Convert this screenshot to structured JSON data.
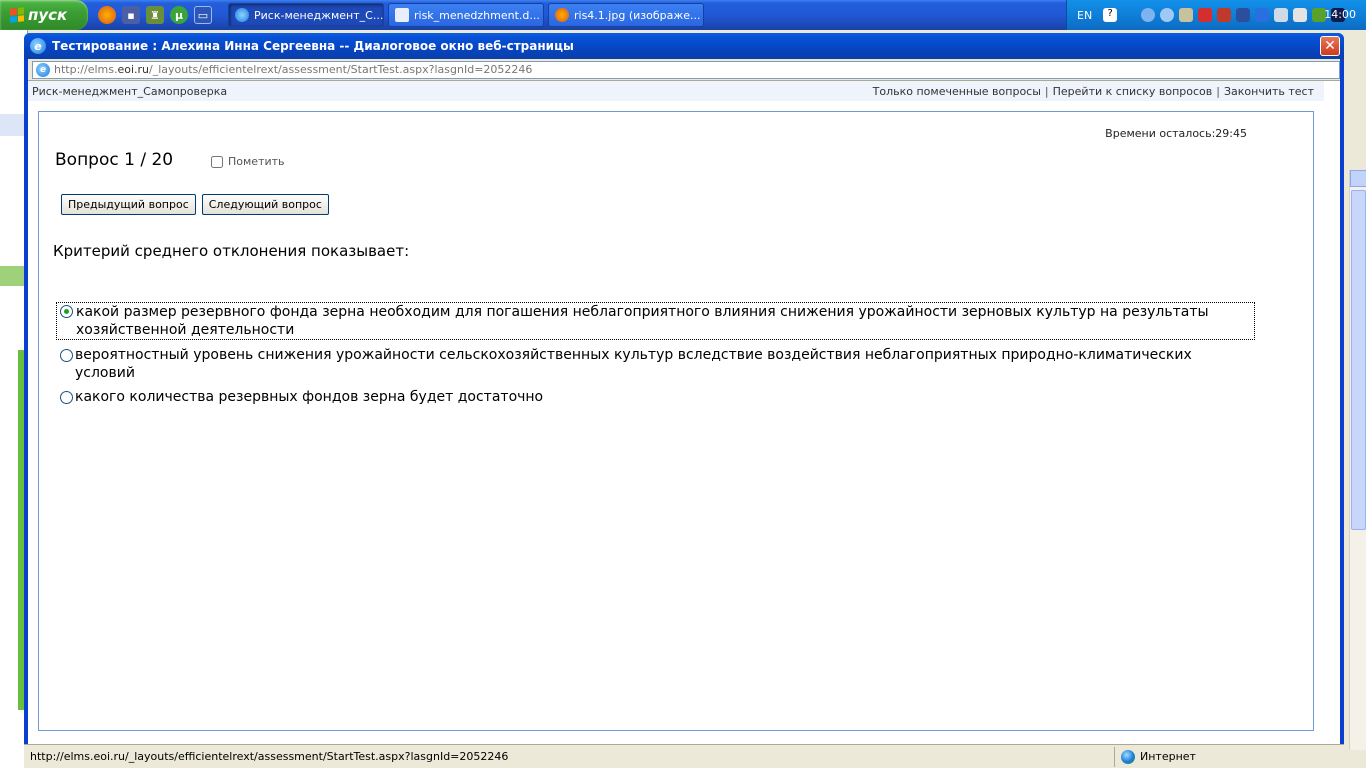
{
  "taskbar": {
    "start_label": "пуск",
    "tasks": [
      {
        "label": "Риск-менеджмент_С...",
        "icon": "ie-icon",
        "active": true
      },
      {
        "label": "risk_menedzhment.d...",
        "icon": "document-icon",
        "active": false
      },
      {
        "label": "ris4.1.jpg (изображе...",
        "icon": "firefox-icon",
        "active": false
      }
    ],
    "lang": "EN",
    "clock": "14:00"
  },
  "dialog": {
    "title": "Тестирование : Алехина Инна Сергеевна -- Диалоговое окно веб-страницы",
    "close_symbol": "✕",
    "address_prefix": "http://elms.",
    "address_domain": "eoi.ru",
    "address_path": "/_layouts/efficientelrext/assessment/StartTest.aspx?lasgnId=2052246"
  },
  "page": {
    "course_name": "Риск-менеджмент_Самопроверка",
    "links": {
      "only_marked": "Только помеченные вопросы",
      "sep1": "|",
      "go_to_list": "Перейти к списку вопросов",
      "sep2": "|",
      "finish": "Закончить тест"
    },
    "timer": "Времени осталось:29:45",
    "question_number": "Вопрос 1 / 20",
    "mark_label": "Пометить",
    "prev_button": "Предыдущий вопрос",
    "next_button": "Следующий вопрос",
    "question_text": "Критерий среднего отклонения показывает:",
    "answers": [
      {
        "text": "какой размер резервного фонда зерна необходим для погашения неблагоприятного влияния снижения урожайности зерновых культур на результаты хозяйственной деятельности",
        "checked": true
      },
      {
        "text": "вероятностный уровень снижения урожайности сельскохозяйственных культур вследствие воздействия неблагоприятных природно-климатических условий",
        "checked": false
      },
      {
        "text": "какого количества резервных фондов зерна будет достаточно",
        "checked": false
      }
    ]
  },
  "statusbar": {
    "url": "http://elms.eoi.ru/_layouts/efficientelrext/assessment/StartTest.aspx?lasgnId=2052246",
    "zone": "Интернет"
  },
  "colors": {
    "titlebar": "#0a4fd6",
    "taskbar": "#245edb",
    "panel_border": "#6f9bd4",
    "radio_dot": "#21a121"
  }
}
